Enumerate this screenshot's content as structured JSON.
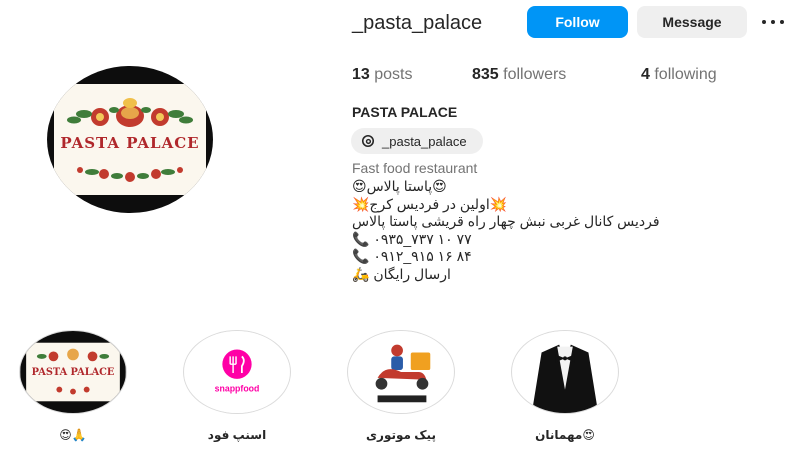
{
  "profile": {
    "username": "_pasta_palace",
    "avatar_logo_text": "PASTA PALACE",
    "full_name": "PASTA PALACE",
    "threads_handle": "_pasta_palace",
    "category": "Fast food restaurant"
  },
  "actions": {
    "follow_label": "Follow",
    "message_label": "Message",
    "more_icon": "more-options-icon"
  },
  "stats": {
    "posts_count": "13",
    "posts_label": "posts",
    "followers_count": "835",
    "followers_label": "followers",
    "following_count": "4",
    "following_label": "following"
  },
  "bio": {
    "line1": "😍پاستا پالاس😍",
    "line2": "💥اولین در فردیس کرج💥",
    "line3": "فردیس کانال غربی نبش چهار راه قریشی پاستا پالاس",
    "line4": "📞 ۰۹۳۵_۷۳۷ ۱۰ ۷۷",
    "line5": "📞 ۰۹۱۲_۹۱۵ ۱۶ ۸۴",
    "line6": "ارسال رایگان 🛵"
  },
  "highlights": [
    {
      "label": "😍🙏",
      "icon": "pasta-palace-logo-icon"
    },
    {
      "label": "اسنپ فود",
      "icon": "snappfood-logo-icon",
      "logo_text": "snappfood"
    },
    {
      "label": "پیک موتوری",
      "icon": "delivery-scooter-icon"
    },
    {
      "label": "مهمانان😍",
      "icon": "tuxedo-icon"
    }
  ],
  "colors": {
    "follow_button": "#0095f6",
    "message_button": "#efefef",
    "snappfood_pink": "#ff00a6",
    "logo_red": "#b0282c"
  }
}
